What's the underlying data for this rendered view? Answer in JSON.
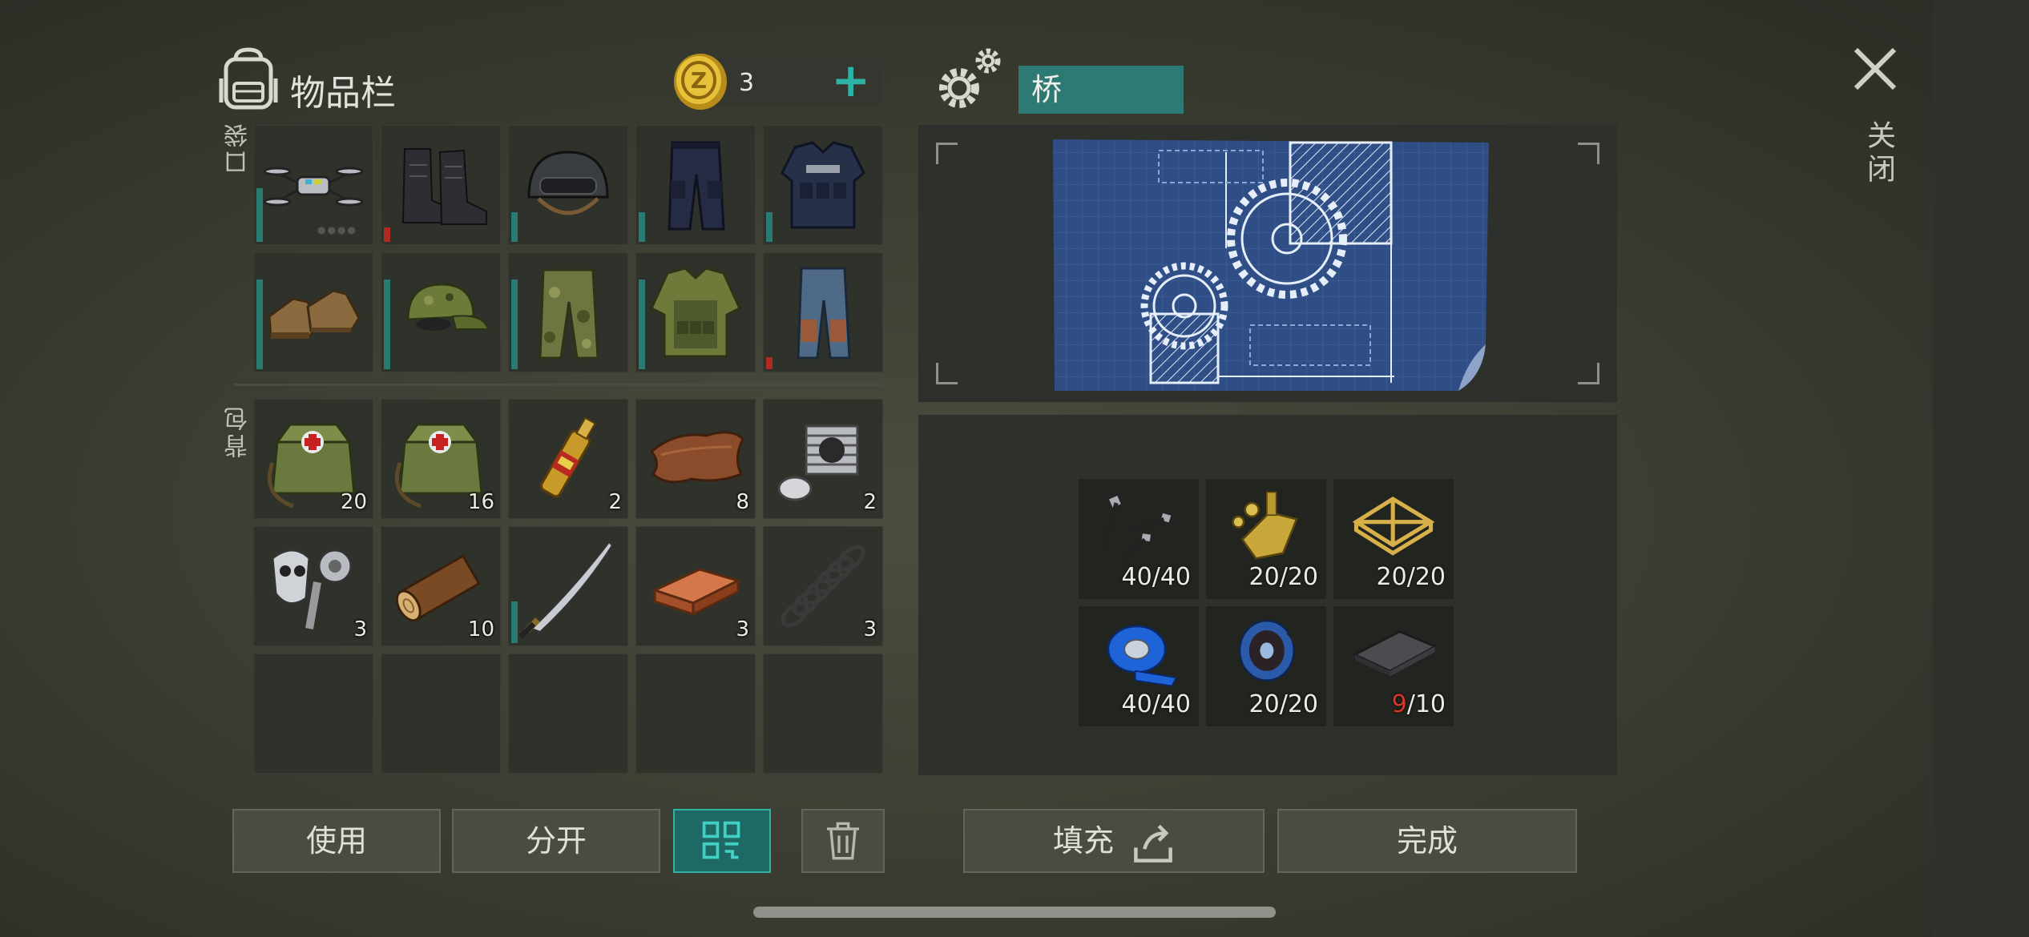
{
  "inventory": {
    "title": "物品栏",
    "coins": "3",
    "pocket_label": "口袋",
    "backpack_label": "背包"
  },
  "pockets": [
    {
      "icon": "drone-icon",
      "durability": 0.45,
      "low": false,
      "dots": "●●●●"
    },
    {
      "icon": "boots-icon",
      "durability": 0.15,
      "low": true
    },
    {
      "icon": "helmet-icon",
      "durability": 0.25,
      "low": false
    },
    {
      "icon": "police-pants-icon",
      "durability": 0.25,
      "low": false
    },
    {
      "icon": "police-vest-icon",
      "durability": 0.25,
      "low": false
    },
    {
      "icon": "leather-shoes-icon",
      "durability": 0.75,
      "low": false
    },
    {
      "icon": "camo-cap-icon",
      "durability": 0.75,
      "low": false
    },
    {
      "icon": "camo-pants-icon",
      "durability": 0.75,
      "low": false
    },
    {
      "icon": "camo-vest-icon",
      "durability": 0.75,
      "low": false
    },
    {
      "icon": "jeans-icon",
      "durability": 0.1,
      "low": true
    }
  ],
  "backpack": [
    {
      "icon": "first-aid-bag-icon",
      "count": "20"
    },
    {
      "icon": "first-aid-bag-icon",
      "count": "16"
    },
    {
      "icon": "ampoule-icon",
      "count": "2"
    },
    {
      "icon": "leather-icon",
      "count": "8"
    },
    {
      "icon": "engine-cylinder-icon",
      "count": "2"
    },
    {
      "icon": "gas-mask-parts-icon",
      "count": "3"
    },
    {
      "icon": "log-icon",
      "count": "10"
    },
    {
      "icon": "katana-icon",
      "count": "",
      "durability": 0.35
    },
    {
      "icon": "copper-ingot-icon",
      "count": "3"
    },
    {
      "icon": "spring-icon",
      "count": "3"
    },
    {
      "icon": "",
      "count": ""
    },
    {
      "icon": "",
      "count": ""
    },
    {
      "icon": "",
      "count": ""
    },
    {
      "icon": "",
      "count": ""
    },
    {
      "icon": "",
      "count": ""
    }
  ],
  "crafting": {
    "name": "桥",
    "close_label": "关闭",
    "blueprint_icon": "gear-blueprint-icon"
  },
  "materials": [
    {
      "icon": "screws-icon",
      "have": "40",
      "need": "/40",
      "short": false
    },
    {
      "icon": "bolts-nuts-icon",
      "have": "20",
      "need": "/20",
      "short": false
    },
    {
      "icon": "frame-icon",
      "have": "20",
      "need": "/20",
      "short": false
    },
    {
      "icon": "blue-tape-icon",
      "have": "40",
      "need": "/40",
      "short": false
    },
    {
      "icon": "wire-spool-icon",
      "have": "20",
      "need": "/20",
      "short": false
    },
    {
      "icon": "metal-plate-icon",
      "have": "9",
      "need": "/10",
      "short": true
    }
  ],
  "buttons": {
    "use": "使用",
    "split": "分开",
    "fill": "填充",
    "done": "完成"
  },
  "colors": {
    "accent": "#2fb2a6",
    "durability": "#2a7a74",
    "low": "#b02a22",
    "missing": "#d8352a"
  }
}
